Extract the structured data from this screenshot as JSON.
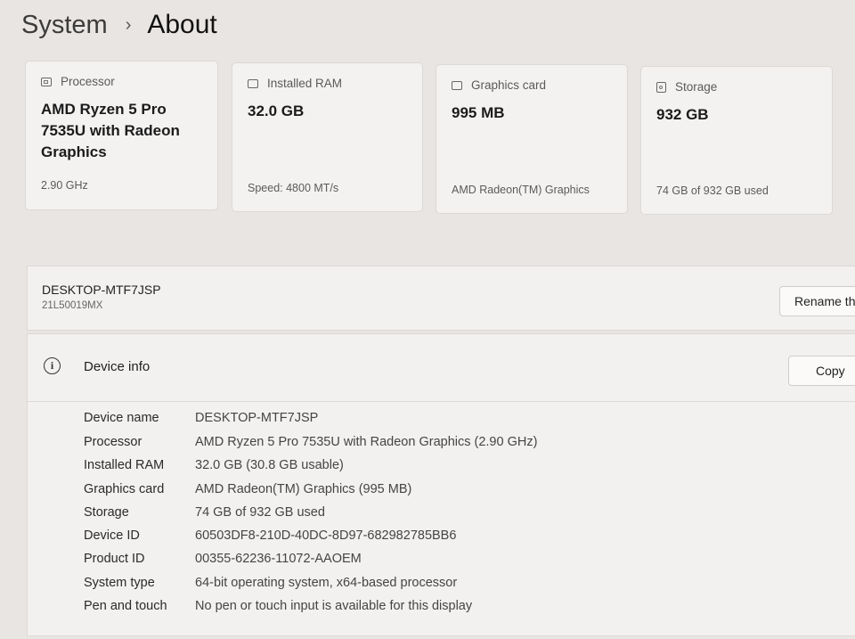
{
  "breadcrumb": {
    "parent": "System",
    "separator": "›",
    "current": "About"
  },
  "cards": [
    {
      "title": "Processor",
      "value": "AMD Ryzen 5 Pro 7535U with Radeon Graphics",
      "sub": "2.90 GHz",
      "icon": "chip-icon"
    },
    {
      "title": "Installed RAM",
      "value": "32.0 GB",
      "sub": "Speed: 4800 MT/s",
      "icon": "ram-icon"
    },
    {
      "title": "Graphics card",
      "value": "995 MB",
      "sub": "AMD Radeon(TM) Graphics",
      "icon": "gpu-icon"
    },
    {
      "title": "Storage",
      "value": "932 GB",
      "sub": "74 GB of 932 GB used",
      "icon": "storage-icon"
    }
  ],
  "device": {
    "name": "DESKTOP-MTF7JSP",
    "model": "21L50019MX",
    "rename_label": "Rename th"
  },
  "device_info": {
    "title": "Device info",
    "copy_label": "Copy",
    "rows": [
      {
        "label": "Device name",
        "value": "DESKTOP-MTF7JSP"
      },
      {
        "label": "Processor",
        "value": "AMD Ryzen 5 Pro 7535U with Radeon Graphics (2.90 GHz)"
      },
      {
        "label": "Installed RAM",
        "value": "32.0 GB (30.8 GB usable)"
      },
      {
        "label": "Graphics card",
        "value": "AMD Radeon(TM) Graphics (995 MB)"
      },
      {
        "label": "Storage",
        "value": "74 GB of 932 GB used"
      },
      {
        "label": "Device ID",
        "value": "60503DF8-210D-40DC-8D97-682982785BB6"
      },
      {
        "label": "Product ID",
        "value": "00355-62236-11072-AAOEM"
      },
      {
        "label": "System type",
        "value": "64-bit operating system, x64-based processor"
      },
      {
        "label": "Pen and touch",
        "value": "No pen or touch input is available for this display"
      }
    ]
  }
}
